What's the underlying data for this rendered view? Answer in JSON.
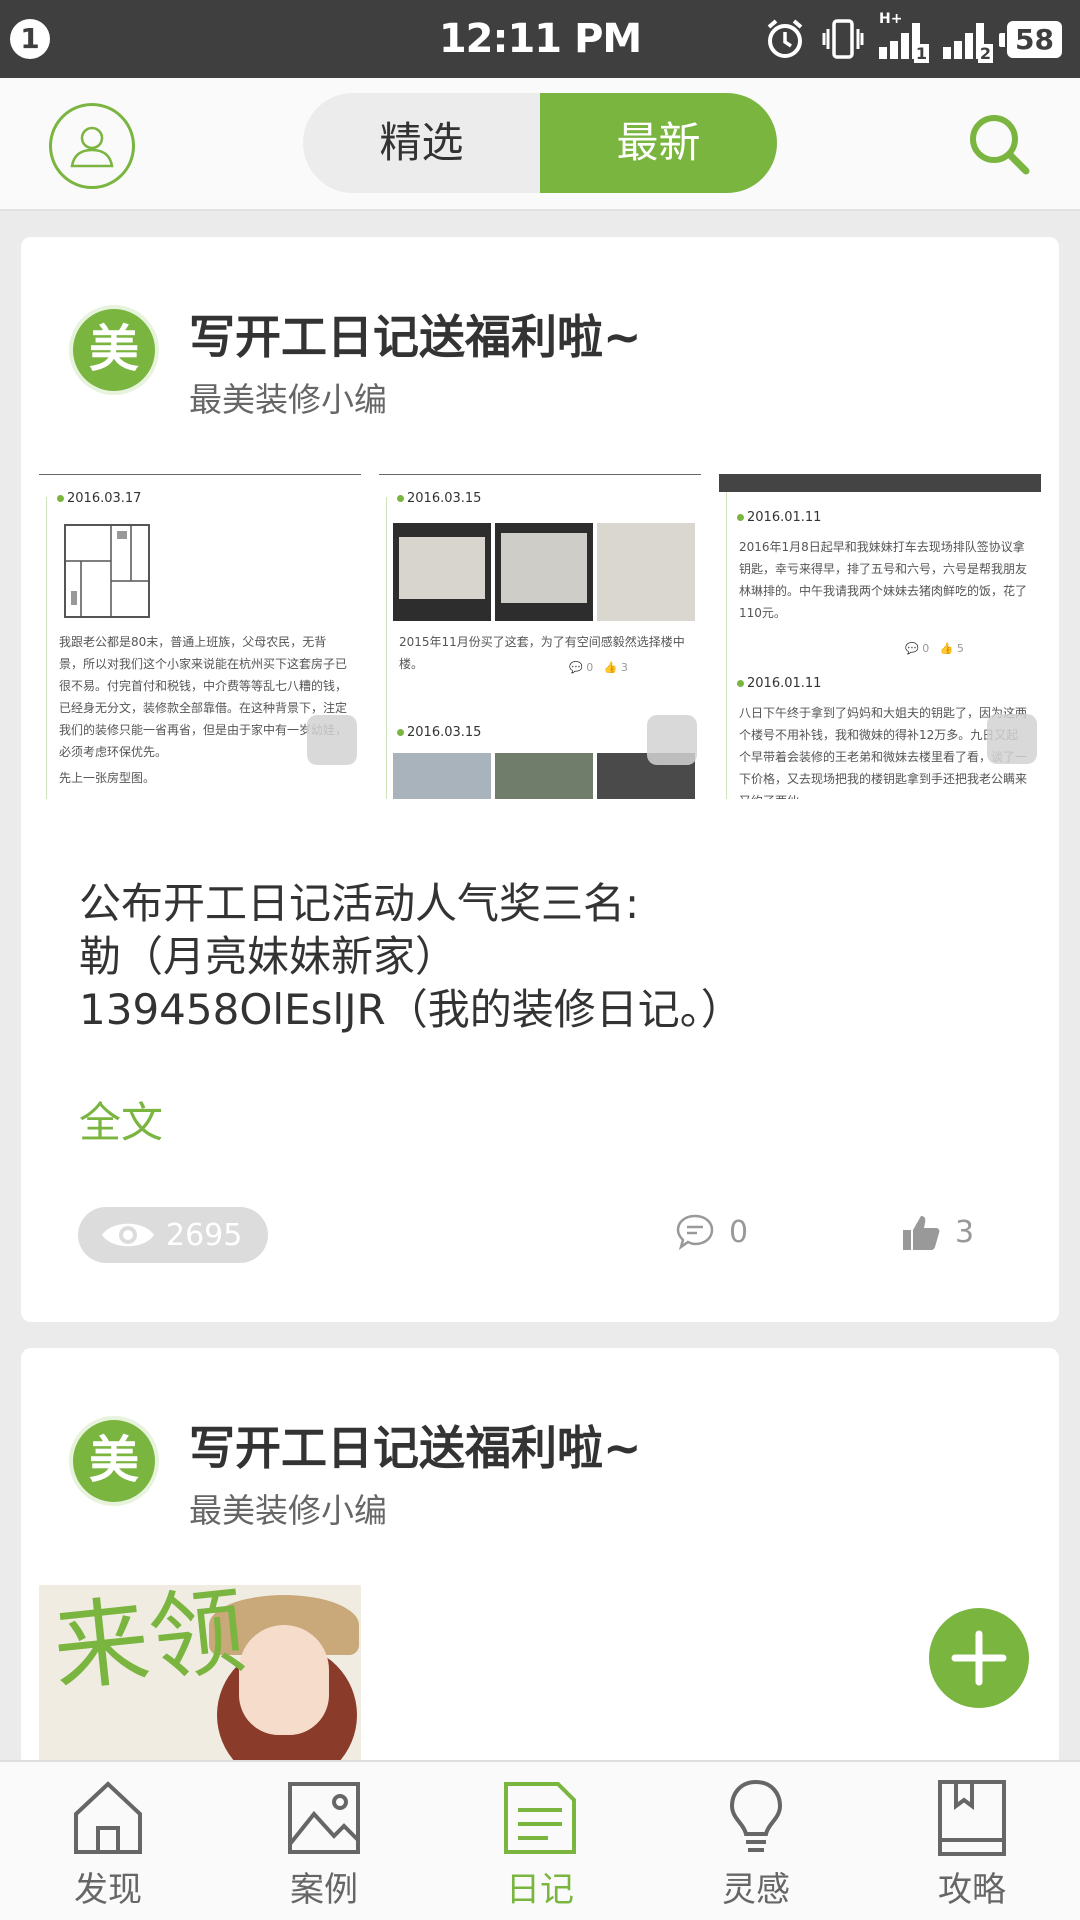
{
  "status_bar": {
    "notification_count": "1",
    "time": "12:11 PM",
    "network": "H+",
    "sim1": "1",
    "sim2": "2",
    "battery": "58"
  },
  "header": {
    "tabs": [
      {
        "label": "精选",
        "active": false
      },
      {
        "label": "最新",
        "active": true
      }
    ],
    "profile_icon": "user-icon",
    "search_icon": "search-icon"
  },
  "posts": [
    {
      "logo_text": "美",
      "title": "写开工日记送福利啦~",
      "author": "最美装修小编",
      "thumbnails": [
        {
          "dates": [
            "2016.03.17"
          ],
          "texts": [
            "我跟老公都是80末，普通上班族，父母农民，无背景，所以对我们这个小家来说能在杭州买下这套房子已很不易。付完首付和税钱，中介费等等乱七八糟的钱，已经身无分文，装修款全部靠借。在这种背景下，注定我们的装修只能一省再省，但是由于家中有一岁幼娃，必须考虑环保优先。",
            "先上一张房型图。"
          ]
        },
        {
          "dates": [
            "2016.03.15",
            "2016.03.15"
          ],
          "texts": [
            "2015年11月份买了这套，为了有空间感毅然选择楼中楼。"
          ],
          "comments": "0",
          "likes": "3"
        },
        {
          "dates": [
            "2016.01.11",
            "2016.01.11"
          ],
          "texts": [
            "2016年1月8日起早和我妹妹打车去现场排队签协议拿钥匙，幸亏来得早，排了五号和六号，六号是帮我朋友林琳排的。中午我请我两个妹妹去猪肉鲜吃的饭，花了110元。",
            "八日下午终于拿到了妈妈和大姐夫的钥匙了，因为这两个楼号不用补钱，我和微妹的得补12万多。九日又起个早带着会装修的王老弟和微妹去楼里看了看，谈了一下价格，又去现场把我的楼钥匙拿到手还把我老公瞒来又约了两伙"
          ],
          "comments": "0",
          "likes": "5"
        }
      ],
      "excerpt_lines": [
        "公布开工日记活动人气奖三名:",
        "勒（月亮妹妹新家）",
        "139458OlEslJR（我的装修日记。）"
      ],
      "read_more": "全文",
      "views": "2695",
      "comments": "0",
      "likes": "3"
    },
    {
      "logo_text": "美",
      "title": "写开工日记送福利啦~",
      "author": "最美装修小编",
      "promo_text": "来领"
    }
  ],
  "fab_icon": "plus-icon",
  "bottom_nav": [
    {
      "label": "发现",
      "icon": "home-icon",
      "active": false
    },
    {
      "label": "案例",
      "icon": "image-icon",
      "active": false
    },
    {
      "label": "日记",
      "icon": "diary-icon",
      "active": true
    },
    {
      "label": "灵感",
      "icon": "lightbulb-icon",
      "active": false
    },
    {
      "label": "攻略",
      "icon": "book-icon",
      "active": false
    }
  ],
  "colors": {
    "accent": "#7ab540",
    "status_bar": "#3f3f3f",
    "background": "#ebebeb"
  }
}
